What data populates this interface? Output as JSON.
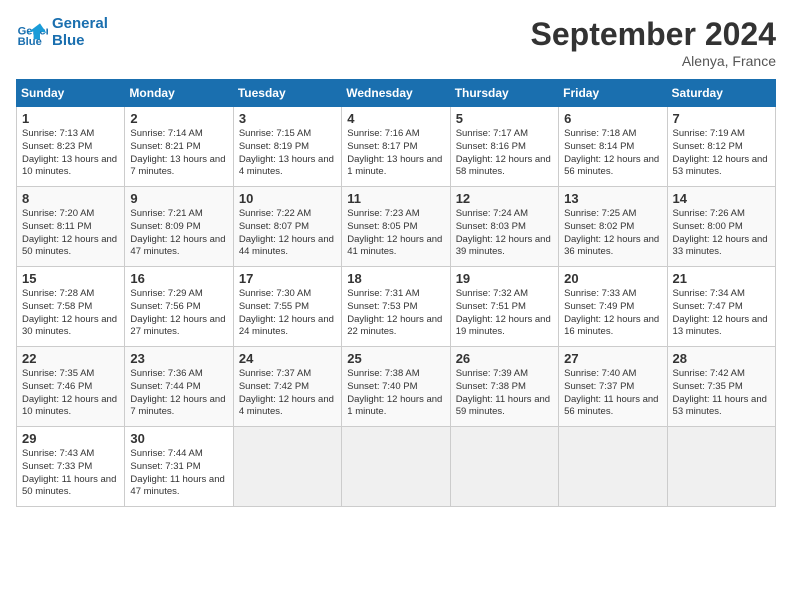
{
  "header": {
    "logo_line1": "General",
    "logo_line2": "Blue",
    "month": "September 2024",
    "location": "Alenya, France"
  },
  "columns": [
    "Sunday",
    "Monday",
    "Tuesday",
    "Wednesday",
    "Thursday",
    "Friday",
    "Saturday"
  ],
  "weeks": [
    [
      {
        "day": "1",
        "rise": "7:13 AM",
        "set": "8:23 PM",
        "hours": "13 hours and 10 minutes."
      },
      {
        "day": "2",
        "rise": "7:14 AM",
        "set": "8:21 PM",
        "hours": "13 hours and 7 minutes."
      },
      {
        "day": "3",
        "rise": "7:15 AM",
        "set": "8:19 PM",
        "hours": "13 hours and 4 minutes."
      },
      {
        "day": "4",
        "rise": "7:16 AM",
        "set": "8:17 PM",
        "hours": "13 hours and 1 minute."
      },
      {
        "day": "5",
        "rise": "7:17 AM",
        "set": "8:16 PM",
        "hours": "12 hours and 58 minutes."
      },
      {
        "day": "6",
        "rise": "7:18 AM",
        "set": "8:14 PM",
        "hours": "12 hours and 56 minutes."
      },
      {
        "day": "7",
        "rise": "7:19 AM",
        "set": "8:12 PM",
        "hours": "12 hours and 53 minutes."
      }
    ],
    [
      {
        "day": "8",
        "rise": "7:20 AM",
        "set": "8:11 PM",
        "hours": "12 hours and 50 minutes."
      },
      {
        "day": "9",
        "rise": "7:21 AM",
        "set": "8:09 PM",
        "hours": "12 hours and 47 minutes."
      },
      {
        "day": "10",
        "rise": "7:22 AM",
        "set": "8:07 PM",
        "hours": "12 hours and 44 minutes."
      },
      {
        "day": "11",
        "rise": "7:23 AM",
        "set": "8:05 PM",
        "hours": "12 hours and 41 minutes."
      },
      {
        "day": "12",
        "rise": "7:24 AM",
        "set": "8:03 PM",
        "hours": "12 hours and 39 minutes."
      },
      {
        "day": "13",
        "rise": "7:25 AM",
        "set": "8:02 PM",
        "hours": "12 hours and 36 minutes."
      },
      {
        "day": "14",
        "rise": "7:26 AM",
        "set": "8:00 PM",
        "hours": "12 hours and 33 minutes."
      }
    ],
    [
      {
        "day": "15",
        "rise": "7:28 AM",
        "set": "7:58 PM",
        "hours": "12 hours and 30 minutes."
      },
      {
        "day": "16",
        "rise": "7:29 AM",
        "set": "7:56 PM",
        "hours": "12 hours and 27 minutes."
      },
      {
        "day": "17",
        "rise": "7:30 AM",
        "set": "7:55 PM",
        "hours": "12 hours and 24 minutes."
      },
      {
        "day": "18",
        "rise": "7:31 AM",
        "set": "7:53 PM",
        "hours": "12 hours and 22 minutes."
      },
      {
        "day": "19",
        "rise": "7:32 AM",
        "set": "7:51 PM",
        "hours": "12 hours and 19 minutes."
      },
      {
        "day": "20",
        "rise": "7:33 AM",
        "set": "7:49 PM",
        "hours": "12 hours and 16 minutes."
      },
      {
        "day": "21",
        "rise": "7:34 AM",
        "set": "7:47 PM",
        "hours": "12 hours and 13 minutes."
      }
    ],
    [
      {
        "day": "22",
        "rise": "7:35 AM",
        "set": "7:46 PM",
        "hours": "12 hours and 10 minutes."
      },
      {
        "day": "23",
        "rise": "7:36 AM",
        "set": "7:44 PM",
        "hours": "12 hours and 7 minutes."
      },
      {
        "day": "24",
        "rise": "7:37 AM",
        "set": "7:42 PM",
        "hours": "12 hours and 4 minutes."
      },
      {
        "day": "25",
        "rise": "7:38 AM",
        "set": "7:40 PM",
        "hours": "12 hours and 1 minute."
      },
      {
        "day": "26",
        "rise": "7:39 AM",
        "set": "7:38 PM",
        "hours": "11 hours and 59 minutes."
      },
      {
        "day": "27",
        "rise": "7:40 AM",
        "set": "7:37 PM",
        "hours": "11 hours and 56 minutes."
      },
      {
        "day": "28",
        "rise": "7:42 AM",
        "set": "7:35 PM",
        "hours": "11 hours and 53 minutes."
      }
    ],
    [
      {
        "day": "29",
        "rise": "7:43 AM",
        "set": "7:33 PM",
        "hours": "11 hours and 50 minutes."
      },
      {
        "day": "30",
        "rise": "7:44 AM",
        "set": "7:31 PM",
        "hours": "11 hours and 47 minutes."
      },
      null,
      null,
      null,
      null,
      null
    ]
  ],
  "labels": {
    "sunrise": "Sunrise:",
    "sunset": "Sunset:",
    "daylight": "Daylight:"
  }
}
